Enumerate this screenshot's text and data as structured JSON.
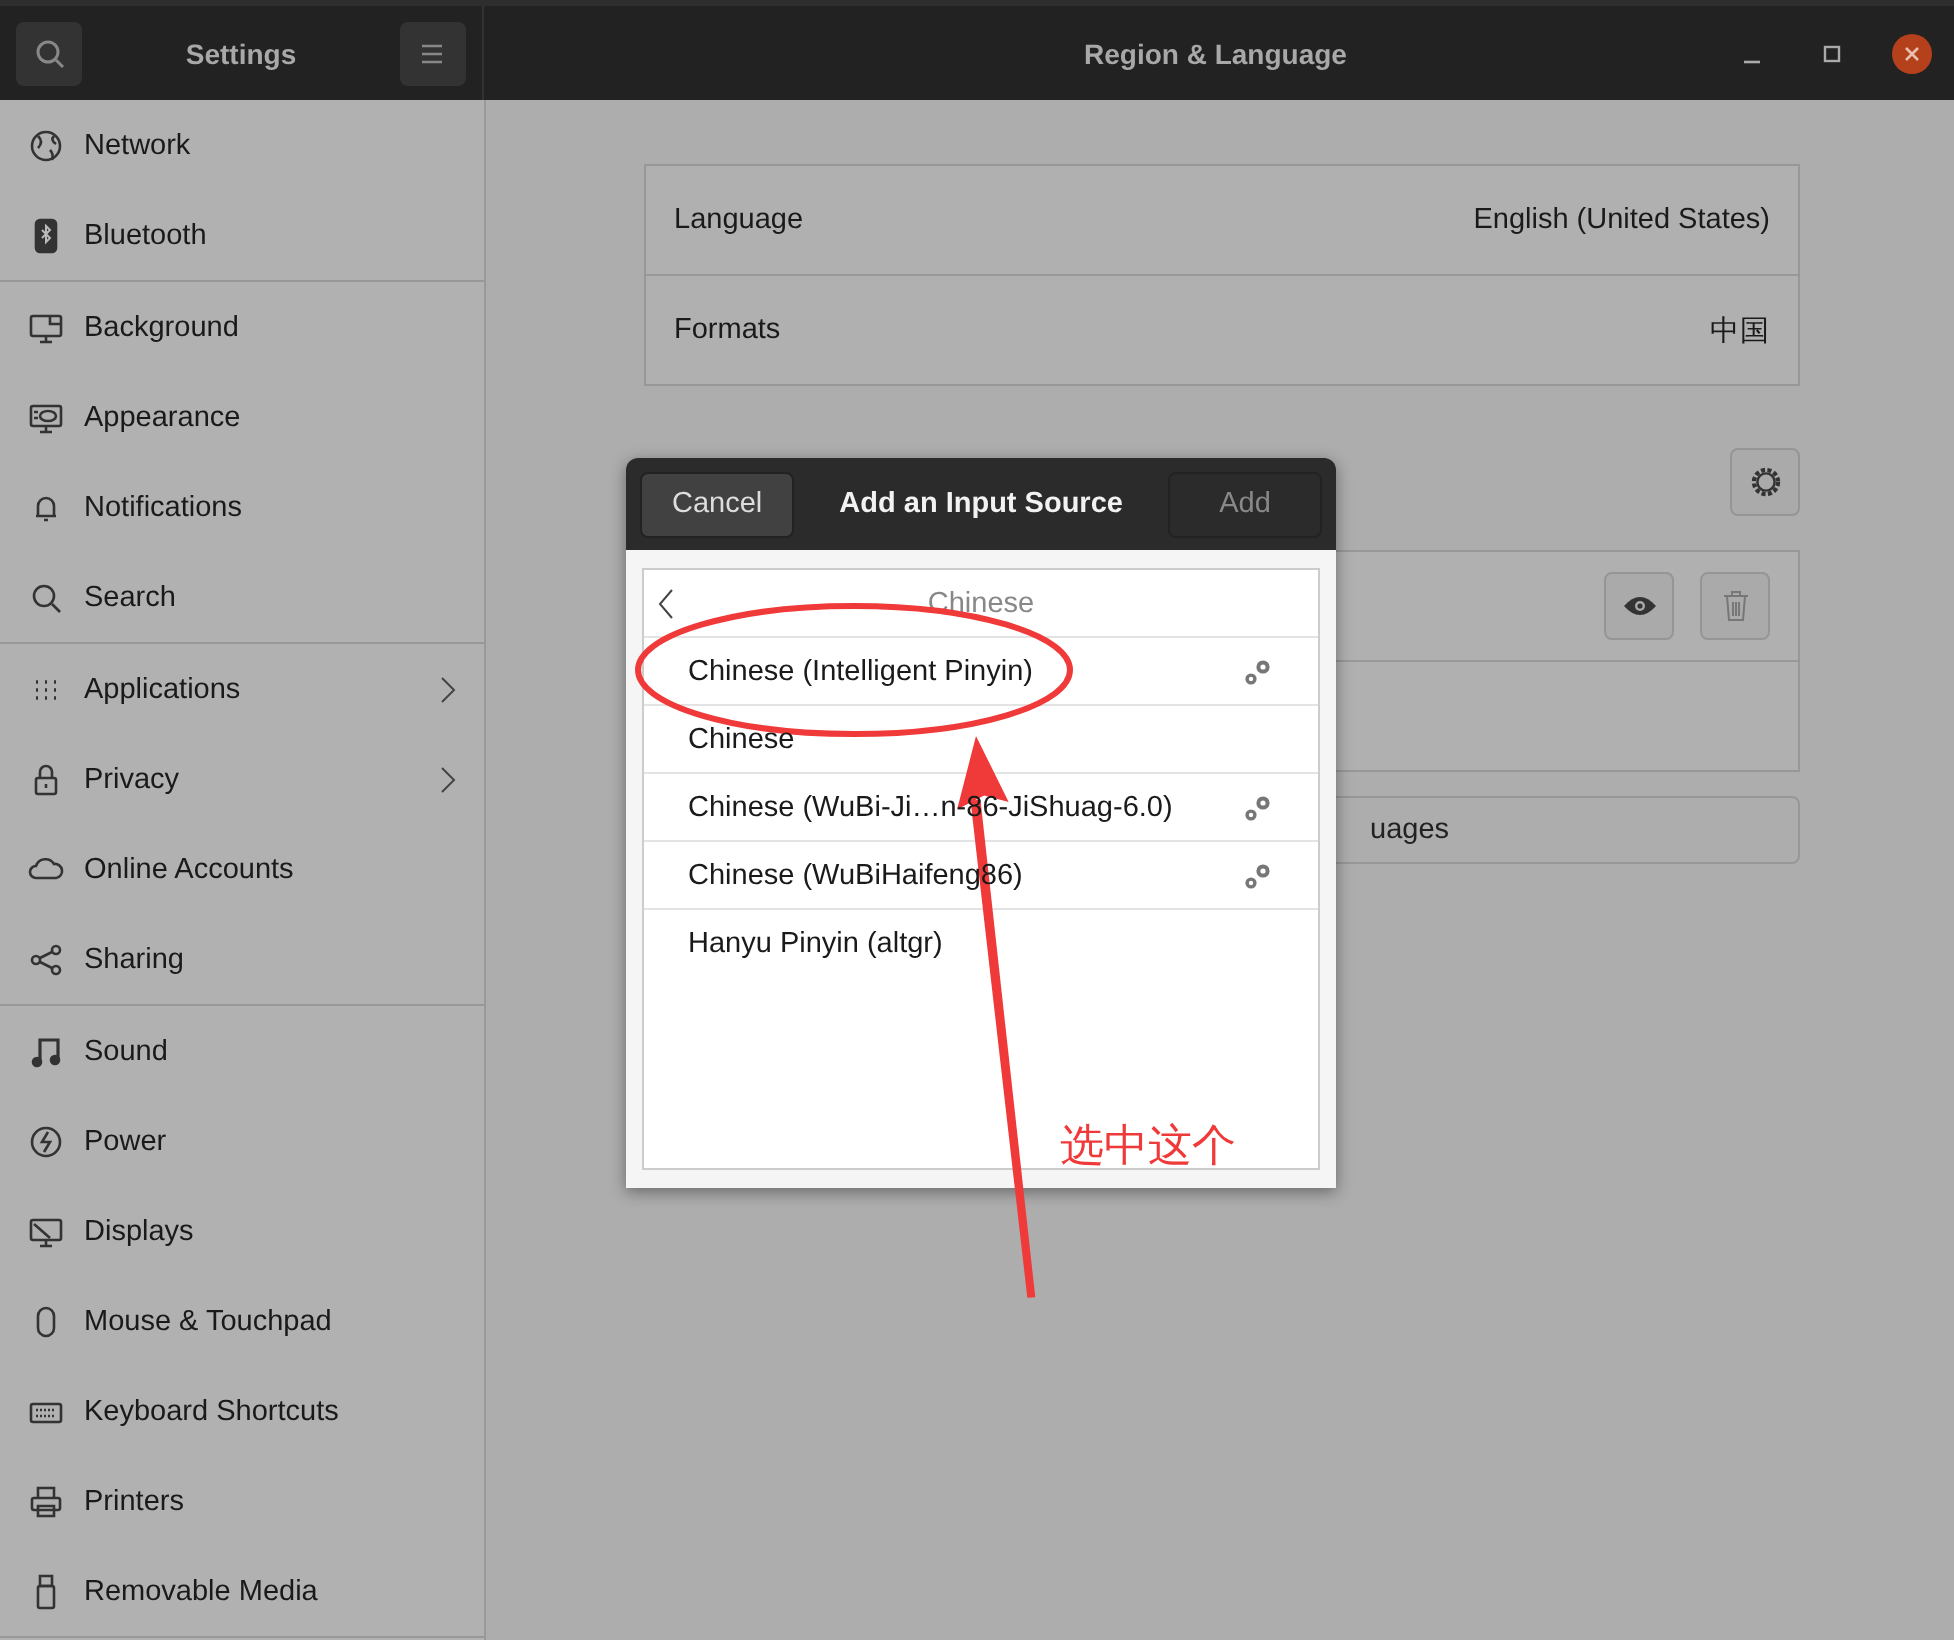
{
  "header": {
    "app_title": "Settings",
    "page_title": "Region & Language"
  },
  "sidebar": {
    "groups": [
      {
        "items": [
          {
            "label": "Network",
            "has_submenu": false
          },
          {
            "label": "Bluetooth",
            "has_submenu": false
          }
        ]
      },
      {
        "items": [
          {
            "label": "Background",
            "has_submenu": false
          },
          {
            "label": "Appearance",
            "has_submenu": false
          },
          {
            "label": "Notifications",
            "has_submenu": false
          },
          {
            "label": "Search",
            "has_submenu": false
          }
        ]
      },
      {
        "items": [
          {
            "label": "Applications",
            "has_submenu": true
          },
          {
            "label": "Privacy",
            "has_submenu": true
          },
          {
            "label": "Online Accounts",
            "has_submenu": false
          },
          {
            "label": "Sharing",
            "has_submenu": false
          }
        ]
      },
      {
        "items": [
          {
            "label": "Sound",
            "has_submenu": false
          },
          {
            "label": "Power",
            "has_submenu": false
          },
          {
            "label": "Displays",
            "has_submenu": false
          },
          {
            "label": "Mouse & Touchpad",
            "has_submenu": false
          },
          {
            "label": "Keyboard Shortcuts",
            "has_submenu": false
          },
          {
            "label": "Printers",
            "has_submenu": false
          },
          {
            "label": "Removable Media",
            "has_submenu": false
          }
        ]
      }
    ]
  },
  "language_settings": [
    {
      "label": "Language",
      "value": "English (United States)"
    },
    {
      "label": "Formats",
      "value": "中国"
    }
  ],
  "manage_button": {
    "label": "uages"
  },
  "dialog": {
    "title": "Add an Input Source",
    "cancel": "Cancel",
    "add": {
      "label": "Add",
      "disabled": true
    },
    "list_header": "Chinese",
    "items": [
      {
        "label": "Chinese (Intelligent Pinyin)",
        "has_settings": true
      },
      {
        "label": "Chinese",
        "has_settings": false
      },
      {
        "label": "Chinese (WuBi-Ji…n-86-JiShuag-6.0)",
        "has_settings": true
      },
      {
        "label": "Chinese (WuBiHaifeng86)",
        "has_settings": true
      },
      {
        "label": "Hanyu Pinyin (altgr)",
        "has_settings": false
      }
    ]
  },
  "annotation": {
    "text": "选中这个"
  }
}
